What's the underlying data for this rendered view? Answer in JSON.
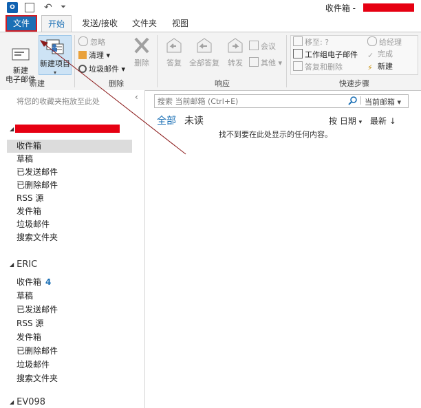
{
  "window": {
    "title": "收件箱 -"
  },
  "colors": {
    "accent": "#1a6fb5",
    "file_tab": "#1a6fb5",
    "highlight_border": "#d21c24",
    "redaction": "#e60012",
    "annotation_arrow": "#8b1a1a"
  },
  "quick_access": {
    "app_icon": "O",
    "undo_icon": "↶",
    "more_icon": "⏷"
  },
  "tabs": [
    {
      "label": "文件"
    },
    {
      "label": "开始"
    },
    {
      "label": "发送/接收"
    },
    {
      "label": "文件夹"
    },
    {
      "label": "视图"
    }
  ],
  "ribbon": {
    "new": {
      "label": "新建",
      "new_email": "新建\n电子邮件",
      "new_items": "新建项目"
    },
    "delete": {
      "label": "删除",
      "ignore": "忽略",
      "cleanup": "清理",
      "junk": "垃圾邮件",
      "delete": "删除"
    },
    "respond": {
      "label": "响应",
      "reply": "答复",
      "reply_all": "全部答复",
      "forward": "转发",
      "meeting": "会议",
      "more": "其他"
    },
    "quick_steps": {
      "label": "快速步骤",
      "move_to": "移至: ?",
      "team_email": "工作组电子邮件",
      "reply_delete": "答复和删除",
      "to_manager": "给经理",
      "done": "完成",
      "create_new": "新建"
    }
  },
  "nav": {
    "favorites_hint": "将您的收藏夹拖放至此处",
    "collapse_icon": "‹",
    "account1": {
      "folders": [
        "收件箱",
        "草稿",
        "已发送邮件",
        "已删除邮件",
        "RSS 源",
        "发件箱",
        "垃圾邮件",
        "搜索文件夹"
      ]
    },
    "account2": {
      "name": "ERIC",
      "inbox": "收件箱",
      "inbox_count": "4",
      "folders": [
        "草稿",
        "已发送邮件",
        "RSS 源",
        "发件箱",
        "已删除邮件",
        "垃圾邮件",
        "搜索文件夹"
      ]
    },
    "account3": {
      "name": "EV098"
    }
  },
  "search": {
    "placeholder": "搜索 当前邮箱 (Ctrl+E)",
    "scope": "当前邮箱"
  },
  "filters": {
    "all": "全部",
    "unread": "未读"
  },
  "sort": {
    "by": "按 日期",
    "order": "最新 ↓"
  },
  "empty_message": "找不到要在此处显示的任何内容。"
}
